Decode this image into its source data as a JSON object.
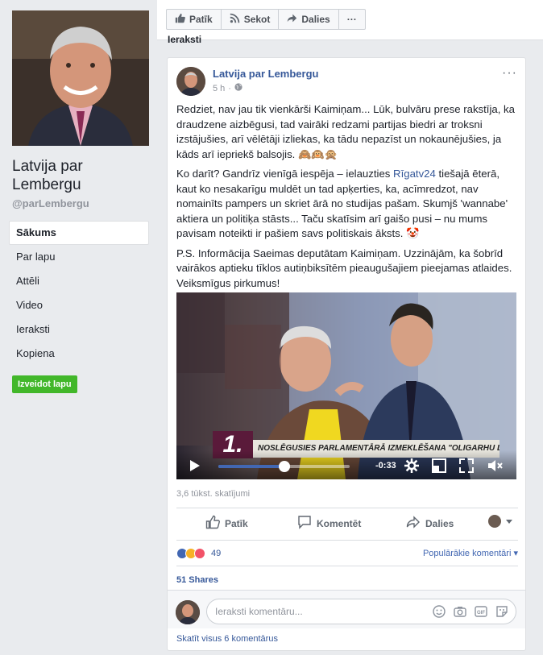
{
  "sidebar": {
    "page_name": "Latvija par Lembergu",
    "handle": "@parLembergu",
    "items": [
      {
        "label": "Sākums",
        "active": true
      },
      {
        "label": "Par lapu"
      },
      {
        "label": "Attēli"
      },
      {
        "label": "Video"
      },
      {
        "label": "Ieraksti"
      },
      {
        "label": "Kopiena"
      }
    ],
    "create_button": "Izveidot lapu"
  },
  "topbar": {
    "like": "Patīk",
    "follow": "Sekot",
    "share": "Dalies",
    "more": "···"
  },
  "section_label": "Ieraksti",
  "post": {
    "author": "Latvija par Lembergu",
    "time": "5 h",
    "more": "···",
    "paragraphs": [
      "Redziet, nav jau tik vienkārši Kaimiņam... Lūk, bulvāru prese rakstīja, ka draudzene aizbēgusi, tad vairāki redzami partijas biedri ar troksni izstājušies, arī vēlētāji izliekas, ka tādu nepazīst un nokaunējušies, ja kāds arī iepriekš balsojis. 🙈🙉🙊"
    ],
    "p2_before": "Ko darīt? Gandrīz vienīgā iespēja – ielauzties ",
    "p2_link": "Rīgatv24",
    "p2_after": " tiešajā ēterā, kaut ko nesakarīgu muldēt un tad apķerties, ka, acīmredzot, nav nomainīts pampers un skriet ārā no studijas pašam. Skumjš 'wannabe' aktiera un politiķa stāsts... Taču skatīsim arī gaišo pusi – nu mums pavisam noteikti ir pašiem savs politiskais āksts. 🤡",
    "p3": "P.S. Informācija Saeimas deputātam Kaimiņam. Uzzinājām, ka šobrīd vairākos aptieku tīklos autiņbiksītēm pieaugušajiem pieejamas atlaides. Veiksmīgus pirkumus!",
    "video": {
      "caption": "NOSLĒGUSIES PARLAMENTĀRĀ IZMEKLĒŠANA \"OLIGARHU LIETĀ\"",
      "number": "1.",
      "time_left": "-0:33",
      "progress": 0.5
    },
    "views": "3,6 tūkst. skatījumi",
    "actions": {
      "like": "Patīk",
      "comment": "Komentēt",
      "share": "Dalies"
    },
    "reaction_count": "49",
    "sort_label": "Populārākie komentāri",
    "shares": "51 Shares",
    "comment_placeholder": "Ieraksti komentāru...",
    "see_all": "Skatīt visus 6 komentārus"
  },
  "colors": {
    "link": "#365899",
    "green": "#42b72a",
    "blue": "#4267b2"
  }
}
